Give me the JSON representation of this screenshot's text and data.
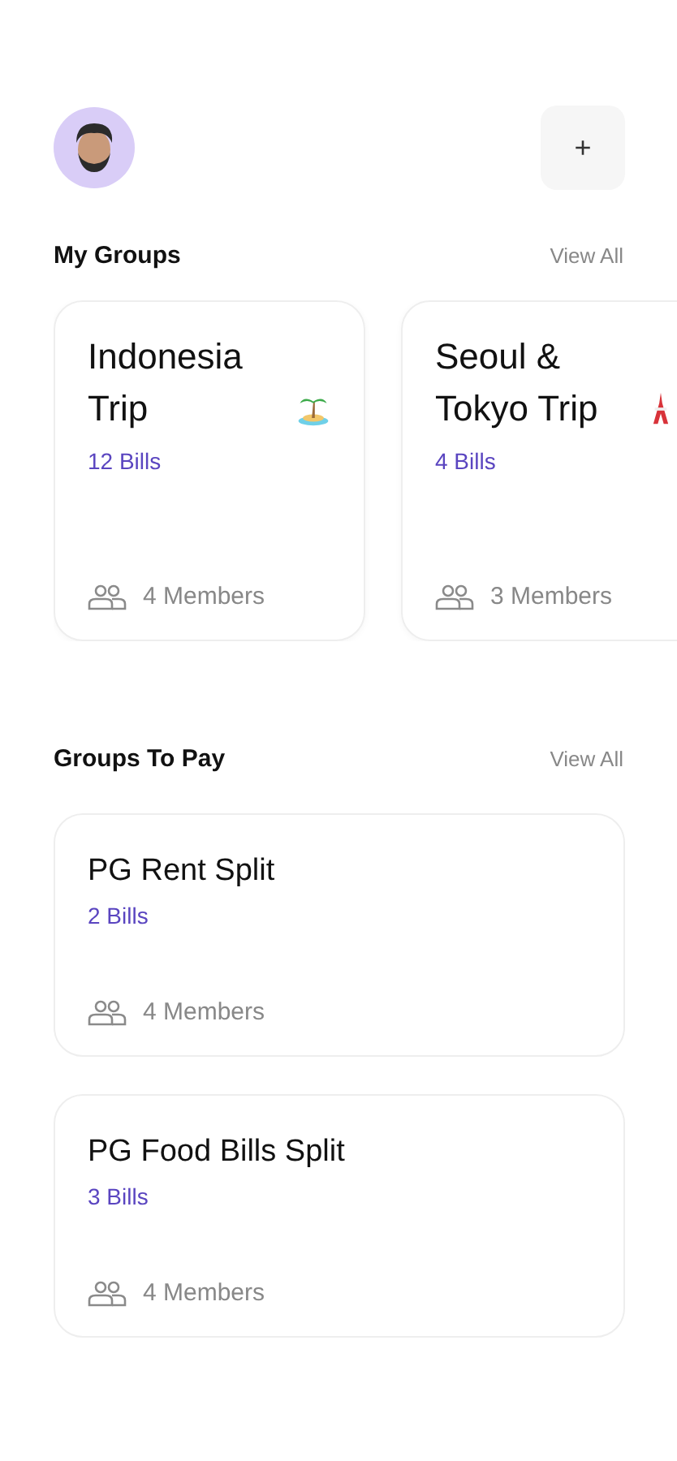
{
  "header": {
    "add_button": "+"
  },
  "my_groups": {
    "title": "My Groups",
    "view_all": "View All",
    "groups": [
      {
        "name": "Indonesia Trip",
        "kind": "island",
        "bills": "12 Bills",
        "members": "4 Members"
      },
      {
        "name": "Seoul & Tokyo Trip",
        "kind": "tower",
        "bills": "4 Bills",
        "members": "3 Members"
      }
    ]
  },
  "groups_to_pay": {
    "title": "Groups To Pay",
    "view_all": "View All",
    "groups": [
      {
        "name": "PG Rent Split",
        "bills": "2 Bills",
        "members": "4 Members"
      },
      {
        "name": "PG Food Bills Split",
        "bills": "3 Bills",
        "members": "4 Members"
      }
    ]
  }
}
